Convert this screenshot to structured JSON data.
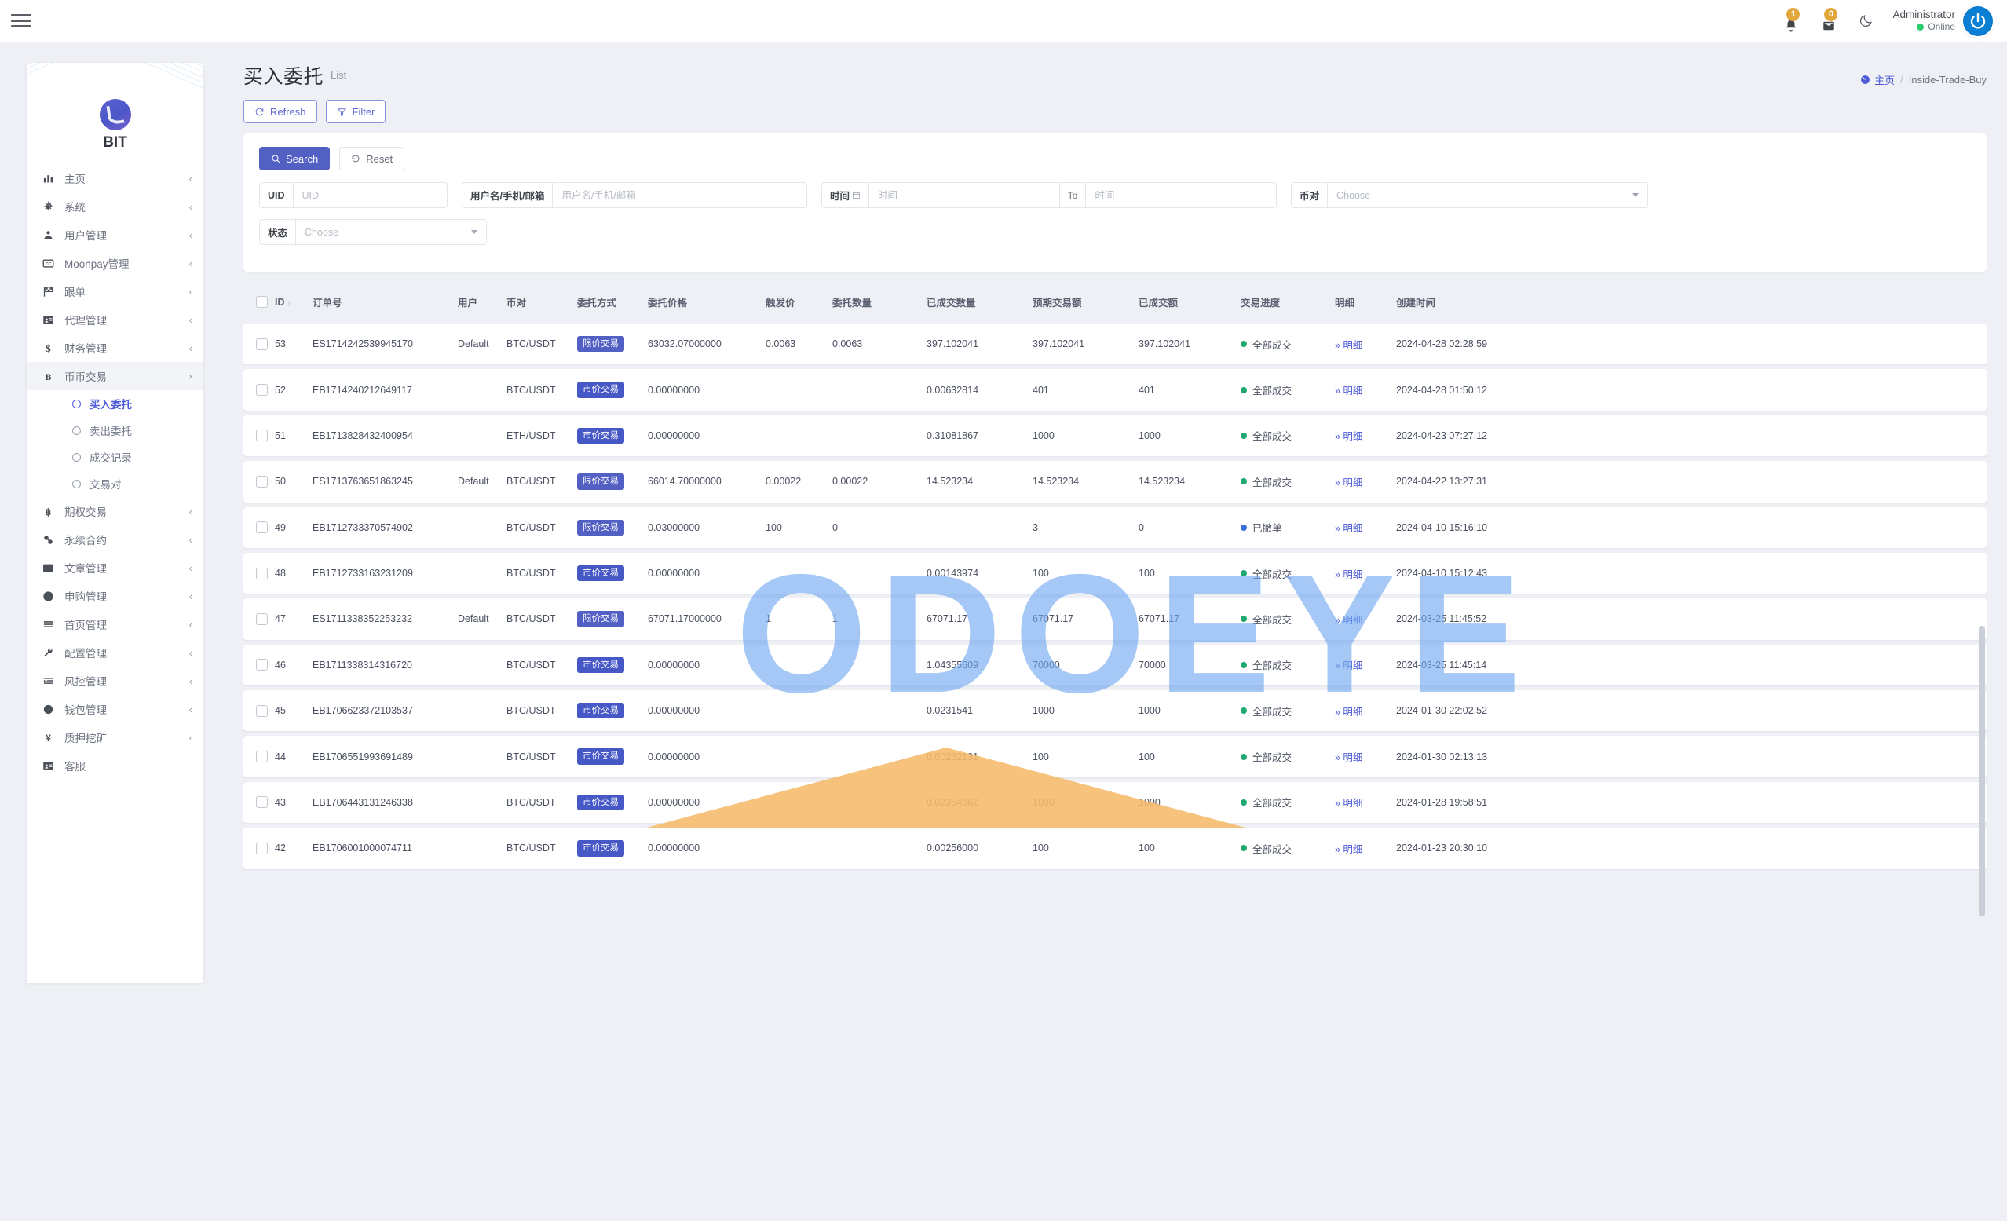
{
  "topbar": {
    "hamburger_icon": "hamburger-icon",
    "notifications": [
      {
        "icon": "bell-icon",
        "count": "1"
      },
      {
        "icon": "envelope-icon",
        "count": "0"
      }
    ],
    "theme_toggle_icon": "moon-icon",
    "user": {
      "name": "Administrator",
      "status": "Online",
      "avatar_icon": "power-icon"
    }
  },
  "sidebar": {
    "brand": "BIT",
    "items": [
      {
        "label": "主页",
        "icon": "chart-bar-icon",
        "chevron": "‹"
      },
      {
        "label": "系统",
        "icon": "gear-icon",
        "chevron": "‹"
      },
      {
        "label": "用户管理",
        "icon": "user-icon",
        "chevron": "‹"
      },
      {
        "label": "Moonpay管理",
        "icon": "cc-icon",
        "chevron": "‹"
      },
      {
        "label": "跟单",
        "icon": "flag-icon",
        "chevron": "‹"
      },
      {
        "label": "代理管理",
        "icon": "id-card-icon",
        "chevron": "‹"
      },
      {
        "label": "财务管理",
        "icon": "dollar-icon",
        "chevron": "‹"
      },
      {
        "label": "币币交易",
        "icon": "bold-b-icon",
        "chevron": "⌄",
        "open": true,
        "children": [
          {
            "label": "买入委托",
            "active": true
          },
          {
            "label": "卖出委托",
            "active": false
          },
          {
            "label": "成交记录",
            "active": false
          },
          {
            "label": "交易对",
            "active": false
          }
        ]
      },
      {
        "label": "期权交易",
        "icon": "bitcoin-icon",
        "chevron": "‹"
      },
      {
        "label": "永续合约",
        "icon": "link-icon",
        "chevron": "‹"
      },
      {
        "label": "文章管理",
        "icon": "news-icon",
        "chevron": "‹"
      },
      {
        "label": "申购管理",
        "icon": "lifebuoy-icon",
        "chevron": "‹"
      },
      {
        "label": "首页管理",
        "icon": "list-icon",
        "chevron": "‹"
      },
      {
        "label": "配置管理",
        "icon": "wrench-icon",
        "chevron": "‹"
      },
      {
        "label": "风控管理",
        "icon": "indent-icon",
        "chevron": "‹"
      },
      {
        "label": "钱包管理",
        "icon": "circle-icon",
        "chevron": "‹"
      },
      {
        "label": "质押挖矿",
        "icon": "yen-icon",
        "chevron": "‹"
      },
      {
        "label": "客服",
        "icon": "contact-card-icon",
        "chevron": ""
      }
    ]
  },
  "page": {
    "title": "买入委托",
    "subtitle": "List",
    "breadcrumb": {
      "home": "主页",
      "separator": "/",
      "current": "Inside-Trade-Buy"
    },
    "toolbar": {
      "refresh": "Refresh",
      "filter": "Filter"
    }
  },
  "search": {
    "search_button": "Search",
    "reset_button": "Reset",
    "fields": {
      "uid": {
        "label": "UID",
        "placeholder": "UID",
        "value": ""
      },
      "user": {
        "label": "用户名/手机/邮箱",
        "placeholder": "用户名/手机/邮箱",
        "value": ""
      },
      "time_from": {
        "label": "时间",
        "placeholder": "时间",
        "value": ""
      },
      "time_to_label": "To",
      "time_to": {
        "placeholder": "时间",
        "value": ""
      },
      "pair": {
        "label": "币对",
        "placeholder": "Choose",
        "value": ""
      },
      "status": {
        "label": "状态",
        "placeholder": "Choose",
        "value": ""
      }
    }
  },
  "table": {
    "headers": [
      "",
      "ID",
      "订单号",
      "用户",
      "币对",
      "委托方式",
      "委托价格",
      "触发价",
      "委托数量",
      "已成交数量",
      "预期交易额",
      "已成交额",
      "交易进度",
      "明细",
      "创建时间"
    ],
    "sort_column": "ID",
    "sort_dir": "↑",
    "detail_label": "明细",
    "rows": [
      {
        "id": "53",
        "order": "ES1714242539945170",
        "user": "Default",
        "pair": "BTC/USDT",
        "way": "限价交易",
        "way_type": "limit",
        "price": "63032.07000000",
        "trigger": "0.0063",
        "qty": "0.0063",
        "done_qty": "397.102041",
        "expected": "397.102041",
        "done_amt": "397.102041",
        "progress": "全部成交",
        "progress_type": "green",
        "time": "2024-04-28 02:28:59"
      },
      {
        "id": "52",
        "order": "EB1714240212649117",
        "user": "",
        "pair": "BTC/USDT",
        "way": "市价交易",
        "way_type": "market",
        "price": "0.00000000",
        "trigger": "",
        "qty": "",
        "done_qty": "0.00632814",
        "expected": "401",
        "done_amt": "401",
        "progress": "全部成交",
        "progress_type": "green",
        "time": "2024-04-28 01:50:12"
      },
      {
        "id": "51",
        "order": "EB1713828432400954",
        "user": "",
        "pair": "ETH/USDT",
        "way": "市价交易",
        "way_type": "market",
        "price": "0.00000000",
        "trigger": "",
        "qty": "",
        "done_qty": "0.31081867",
        "expected": "1000",
        "done_amt": "1000",
        "progress": "全部成交",
        "progress_type": "green",
        "time": "2024-04-23 07:27:12"
      },
      {
        "id": "50",
        "order": "ES1713763651863245",
        "user": "Default",
        "pair": "BTC/USDT",
        "way": "限价交易",
        "way_type": "limit",
        "price": "66014.70000000",
        "trigger": "0.00022",
        "qty": "0.00022",
        "done_qty": "14.523234",
        "expected": "14.523234",
        "done_amt": "14.523234",
        "progress": "全部成交",
        "progress_type": "green",
        "time": "2024-04-22 13:27:31"
      },
      {
        "id": "49",
        "order": "EB1712733370574902",
        "user": "",
        "pair": "BTC/USDT",
        "way": "限价交易",
        "way_type": "limit",
        "price": "0.03000000",
        "trigger": "100",
        "qty": "0",
        "done_qty": "",
        "expected": "3",
        "done_amt": "0",
        "progress": "已撤单",
        "progress_type": "blue",
        "time": "2024-04-10 15:16:10"
      },
      {
        "id": "48",
        "order": "EB1712733163231209",
        "user": "",
        "pair": "BTC/USDT",
        "way": "市价交易",
        "way_type": "market",
        "price": "0.00000000",
        "trigger": "",
        "qty": "",
        "done_qty": "0.00143974",
        "expected": "100",
        "done_amt": "100",
        "progress": "全部成交",
        "progress_type": "green",
        "time": "2024-04-10 15:12:43"
      },
      {
        "id": "47",
        "order": "ES1711338352253232",
        "user": "Default",
        "pair": "BTC/USDT",
        "way": "限价交易",
        "way_type": "limit",
        "price": "67071.17000000",
        "trigger": "1",
        "qty": "1",
        "done_qty": "67071.17",
        "expected": "67071.17",
        "done_amt": "67071.17",
        "progress": "全部成交",
        "progress_type": "green",
        "time": "2024-03-25 11:45:52"
      },
      {
        "id": "46",
        "order": "EB1711338314316720",
        "user": "",
        "pair": "BTC/USDT",
        "way": "市价交易",
        "way_type": "market",
        "price": "0.00000000",
        "trigger": "",
        "qty": "",
        "done_qty": "1.04355609",
        "expected": "70000",
        "done_amt": "70000",
        "progress": "全部成交",
        "progress_type": "green",
        "time": "2024-03-25 11:45:14"
      },
      {
        "id": "45",
        "order": "EB1706623372103537",
        "user": "",
        "pair": "BTC/USDT",
        "way": "市价交易",
        "way_type": "market",
        "price": "0.00000000",
        "trigger": "",
        "qty": "",
        "done_qty": "0.0231541",
        "expected": "1000",
        "done_amt": "1000",
        "progress": "全部成交",
        "progress_type": "green",
        "time": "2024-01-30 22:02:52"
      },
      {
        "id": "44",
        "order": "EB1706551993691489",
        "user": "",
        "pair": "BTC/USDT",
        "way": "市价交易",
        "way_type": "market",
        "price": "0.00000000",
        "trigger": "",
        "qty": "",
        "done_qty": "0.00232131",
        "expected": "100",
        "done_amt": "100",
        "progress": "全部成交",
        "progress_type": "green",
        "time": "2024-01-30 02:13:13"
      },
      {
        "id": "43",
        "order": "EB1706443131246338",
        "user": "",
        "pair": "BTC/USDT",
        "way": "市价交易",
        "way_type": "market",
        "price": "0.00000000",
        "trigger": "",
        "qty": "",
        "done_qty": "0.02354662",
        "expected": "1000",
        "done_amt": "1000",
        "progress": "全部成交",
        "progress_type": "green",
        "time": "2024-01-28 19:58:51"
      },
      {
        "id": "42",
        "order": "EB1706001000074711",
        "user": "",
        "pair": "BTC/USDT",
        "way": "市价交易",
        "way_type": "market",
        "price": "0.00000000",
        "trigger": "",
        "qty": "",
        "done_qty": "0.00256000",
        "expected": "100",
        "done_amt": "100",
        "progress": "全部成交",
        "progress_type": "green",
        "time": "2024-01-23 20:30:10"
      }
    ]
  },
  "watermark": {
    "text": "ODOEYE"
  },
  "colors": {
    "primary": "#5260c4",
    "accent": "#4d5bd6",
    "success": "#1fa971",
    "info": "#3b6ddb",
    "badge": "#e2a63b"
  }
}
